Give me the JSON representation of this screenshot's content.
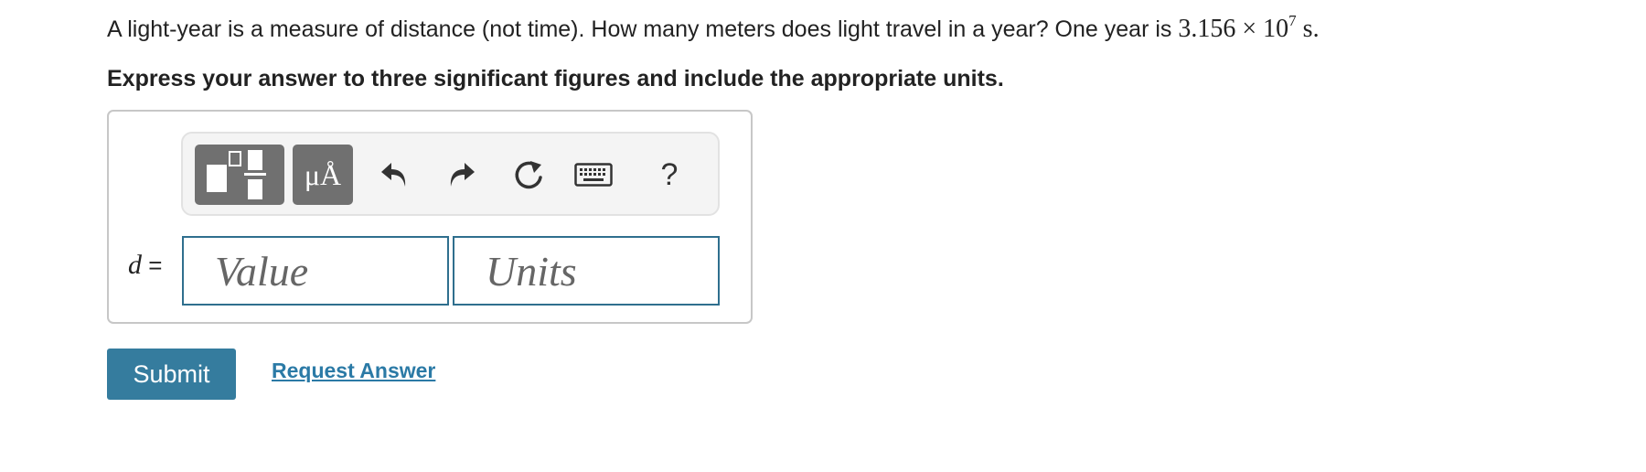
{
  "question": {
    "text": "A light-year is a measure of distance (not time). How many meters does light travel in a year? One year is",
    "value_mantissa": "3.156",
    "times": "×",
    "base": "10",
    "exponent": "7",
    "unit": "s",
    "period": "."
  },
  "instruction": "Express your answer to three significant figures and include the appropriate units.",
  "toolbar": {
    "templates_icon": "templates-icon",
    "units_label": "μÅ",
    "undo_icon": "undo-icon",
    "redo_icon": "redo-icon",
    "reset_icon": "reset-icon",
    "keyboard_icon": "keyboard-icon",
    "help_label": "?"
  },
  "answer": {
    "variable": "d",
    "equals": "=",
    "value_placeholder": "Value",
    "units_placeholder": "Units"
  },
  "actions": {
    "submit_label": "Submit",
    "request_label": "Request Answer"
  },
  "colors": {
    "primary": "#357c9e",
    "link": "#2b7aa6",
    "field_border": "#2f6f8e",
    "toolbar_button": "#707070"
  }
}
